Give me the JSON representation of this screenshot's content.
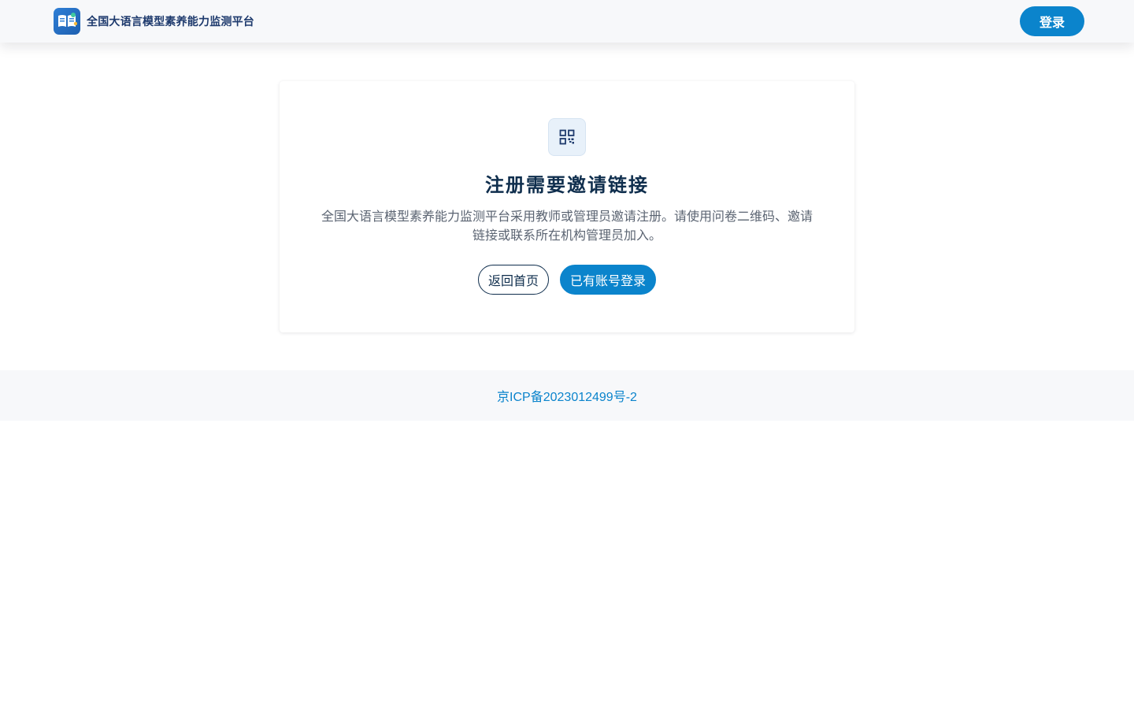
{
  "header": {
    "app_title": "全国大语言模型素养能力监测平台",
    "login_label": "登录",
    "logo_icon": "book-chat-logo-icon"
  },
  "card": {
    "icon": "qr-code-icon",
    "title": "注册需要邀请链接",
    "description": "全国大语言模型素养能力监测平台采用教师或管理员邀请注册。请使用问卷二维码、邀请链接或联系所在机构管理员加入。",
    "back_home_label": "返回首页",
    "have_account_label": "已有账号登录"
  },
  "footer": {
    "icp_text": "京ICP备2023012499号-2"
  },
  "colors": {
    "primary": "#0b84cc",
    "title": "#0f2e4d",
    "header_bg": "#f7f8fa",
    "text_muted": "#5b6472"
  }
}
